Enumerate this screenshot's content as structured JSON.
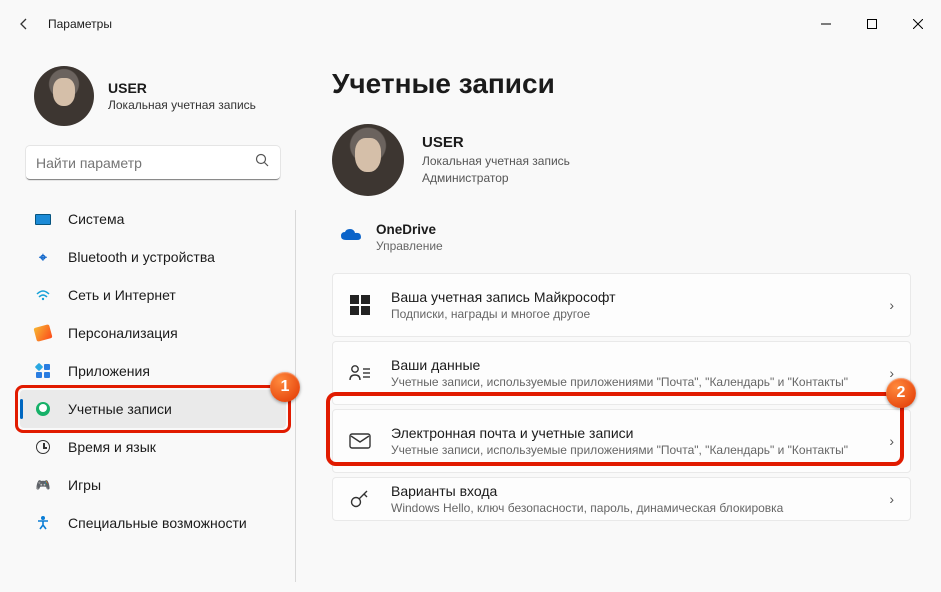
{
  "titlebar": {
    "title": "Параметры"
  },
  "user": {
    "name": "USER",
    "sub": "Локальная учетная запись"
  },
  "search": {
    "placeholder": "Найти параметр"
  },
  "sidebar": {
    "items": [
      {
        "label": "Система"
      },
      {
        "label": "Bluetooth и устройства"
      },
      {
        "label": "Сеть и Интернет"
      },
      {
        "label": "Персонализация"
      },
      {
        "label": "Приложения"
      },
      {
        "label": "Учетные записи"
      },
      {
        "label": "Время и язык"
      },
      {
        "label": "Игры"
      },
      {
        "label": "Специальные возможности"
      }
    ]
  },
  "main": {
    "title": "Учетные записи",
    "profile": {
      "name": "USER",
      "sub1": "Локальная учетная запись",
      "sub2": "Администратор"
    },
    "onedrive": {
      "title": "OneDrive",
      "sub": "Управление"
    },
    "cards": [
      {
        "title": "Ваша учетная запись Майкрософт",
        "sub": "Подписки, награды и многое другое"
      },
      {
        "title": "Ваши данные",
        "sub": "Учетные записи, используемые приложениями \"Почта\", \"Календарь\" и \"Контакты\""
      },
      {
        "title": "Электронная почта и учетные записи",
        "sub": "Учетные записи, используемые приложениями \"Почта\", \"Календарь\" и \"Контакты\""
      },
      {
        "title": "Варианты входа",
        "sub": "Windows Hello, ключ безопасности, пароль, динамическая блокировка"
      }
    ]
  },
  "annotations": {
    "1": "1",
    "2": "2"
  }
}
